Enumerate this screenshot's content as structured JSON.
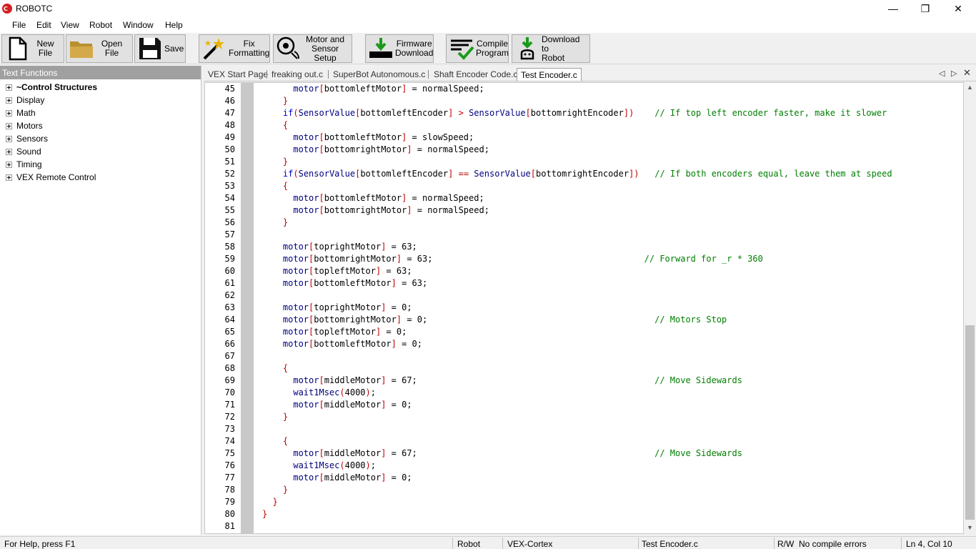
{
  "window": {
    "title": "ROBOTC"
  },
  "menu": [
    "File",
    "Edit",
    "View",
    "Robot",
    "Window",
    "Help"
  ],
  "toolbar": {
    "new_file": "New File",
    "open_file": "Open File",
    "save": "Save",
    "fix_formatting": [
      "Fix",
      "Formatting"
    ],
    "motor_sensor_setup": [
      "Motor and",
      "Sensor Setup"
    ],
    "firmware_download": [
      "Firmware",
      "Download"
    ],
    "compile_program": [
      "Compile",
      "Program"
    ],
    "download_to_robot": [
      "Download to",
      "Robot"
    ]
  },
  "left_panel": {
    "header": "Text Functions",
    "items": [
      "~Control Structures",
      "Display",
      "Math",
      "Motors",
      "Sensors",
      "Sound",
      "Timing",
      "VEX Remote Control"
    ]
  },
  "tabs": [
    "VEX Start Page",
    "freaking out.c",
    "SuperBot Autonomous.c",
    "Shaft Encoder Code.c",
    "Test Encoder.c"
  ],
  "active_tab": "Test Encoder.c",
  "code_lines": [
    {
      "n": "45",
      "t": "      motor[bottomleftMotor] = normalSpeed;"
    },
    {
      "n": "46",
      "t": "    }"
    },
    {
      "n": "47",
      "t": "    if(SensorValue[bottomleftEncoder] > SensorValue[bottomrightEncoder])    // If top left encoder faster, make it slower"
    },
    {
      "n": "48",
      "t": "    {"
    },
    {
      "n": "49",
      "t": "      motor[bottomleftMotor] = slowSpeed;"
    },
    {
      "n": "50",
      "t": "      motor[bottomrightMotor] = normalSpeed;"
    },
    {
      "n": "51",
      "t": "    }"
    },
    {
      "n": "52",
      "t": "    if(SensorValue[bottomleftEncoder] == SensorValue[bottomrightEncoder])   // If both encoders equal, leave them at speed"
    },
    {
      "n": "53",
      "t": "    {"
    },
    {
      "n": "54",
      "t": "      motor[bottomleftMotor] = normalSpeed;"
    },
    {
      "n": "55",
      "t": "      motor[bottomrightMotor] = normalSpeed;"
    },
    {
      "n": "56",
      "t": "    }"
    },
    {
      "n": "57",
      "t": ""
    },
    {
      "n": "58",
      "t": "    motor[toprightMotor] = 63;"
    },
    {
      "n": "59",
      "t": "    motor[bottomrightMotor] = 63;                                         // Forward for _r * 360"
    },
    {
      "n": "60",
      "t": "    motor[topleftMotor] = 63;"
    },
    {
      "n": "61",
      "t": "    motor[bottomleftMotor] = 63;"
    },
    {
      "n": "62",
      "t": ""
    },
    {
      "n": "63",
      "t": "    motor[toprightMotor] = 0;"
    },
    {
      "n": "64",
      "t": "    motor[bottomrightMotor] = 0;                                            // Motors Stop"
    },
    {
      "n": "65",
      "t": "    motor[topleftMotor] = 0;"
    },
    {
      "n": "66",
      "t": "    motor[bottomleftMotor] = 0;"
    },
    {
      "n": "67",
      "t": ""
    },
    {
      "n": "68",
      "t": "    {"
    },
    {
      "n": "69",
      "t": "      motor[middleMotor] = 67;                                              // Move Sidewards"
    },
    {
      "n": "70",
      "t": "      wait1Msec(4000);"
    },
    {
      "n": "71",
      "t": "      motor[middleMotor] = 0;"
    },
    {
      "n": "72",
      "t": "    }"
    },
    {
      "n": "73",
      "t": ""
    },
    {
      "n": "74",
      "t": "    {"
    },
    {
      "n": "75",
      "t": "      motor[middleMotor] = 67;                                              // Move Sidewards"
    },
    {
      "n": "76",
      "t": "      wait1Msec(4000);"
    },
    {
      "n": "77",
      "t": "      motor[middleMotor] = 0;"
    },
    {
      "n": "78",
      "t": "    }"
    },
    {
      "n": "79",
      "t": "  }"
    },
    {
      "n": "80",
      "t": "}"
    },
    {
      "n": "81",
      "t": ""
    }
  ],
  "status": {
    "help": "For Help, press F1",
    "robot": "Robot",
    "platform": "VEX-Cortex",
    "file": "Test Encoder.c",
    "rw": "R/W",
    "compile": "No compile errors",
    "position": "Ln 4, Col 10"
  }
}
